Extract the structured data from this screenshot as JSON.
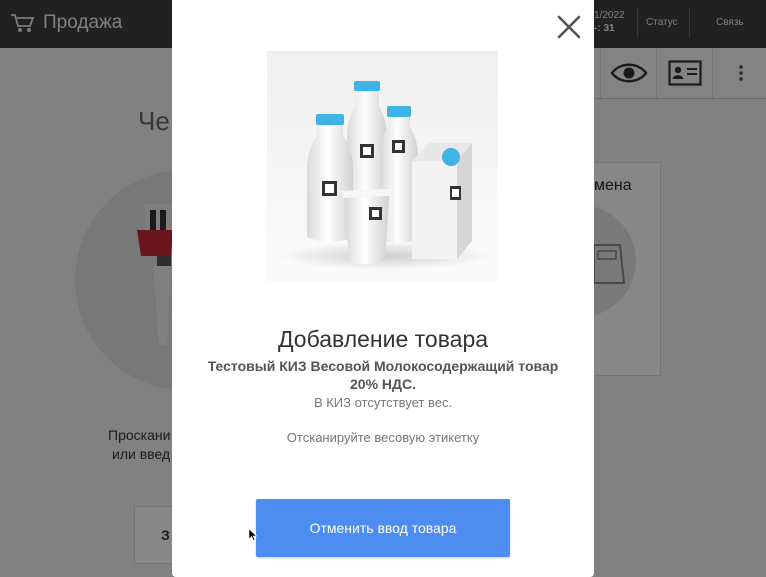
{
  "header": {
    "app_title": "Продажа",
    "date_line": "1/2022",
    "time_line": "-: 31",
    "status_label": "Статус",
    "link_label": "Связь"
  },
  "background": {
    "check_title": "Че",
    "scan_line1": "Проскани",
    "scan_line2": "или введ",
    "left_button_label": "З",
    "right_card_label": "мена"
  },
  "modal": {
    "title": "Добавление товара",
    "product_name": "Тестовый КИЗ Весовой Молокосодержащий товар 20% НДС.",
    "warning": "В КИЗ отсутствует вес.",
    "instruction": "Отсканируйте весовую этикетку",
    "cancel_button_label": "Отменить ввод товара"
  },
  "icons": {
    "cart": "cart-icon",
    "eye": "eye-icon",
    "contact_card": "contact-card-icon",
    "more": "more-vertical-icon",
    "close": "close-icon"
  },
  "colors": {
    "accent": "#4d8df0",
    "topbar": "#3f3f3f",
    "cap_blue": "#3fb3e6"
  }
}
